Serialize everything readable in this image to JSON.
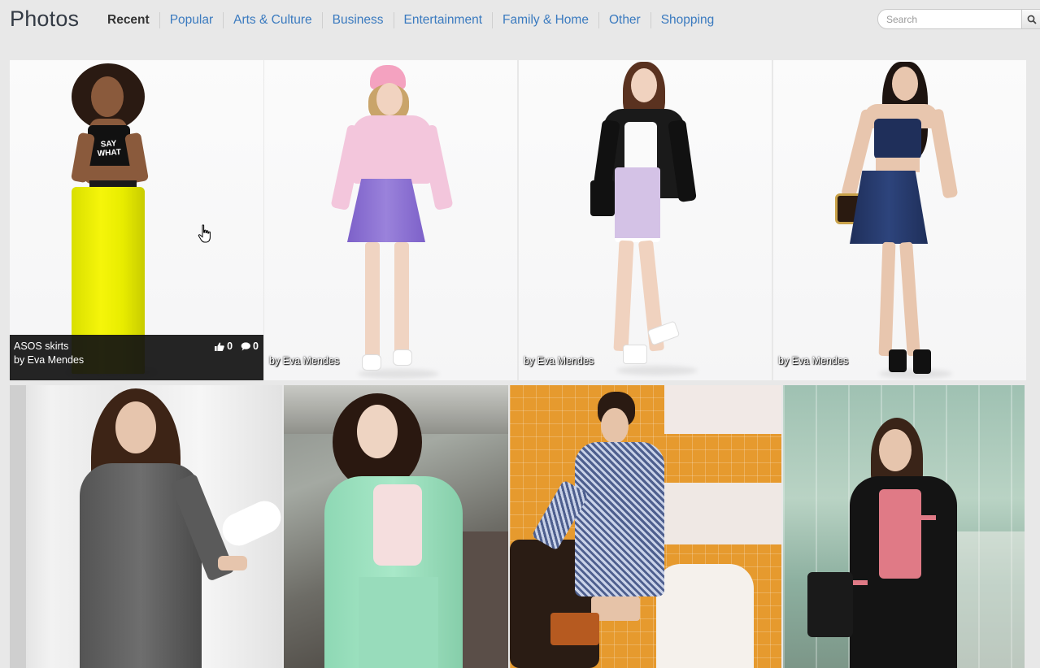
{
  "app": {
    "title": "Photos"
  },
  "nav": {
    "items": [
      {
        "label": "Recent",
        "active": true
      },
      {
        "label": "Popular",
        "active": false
      },
      {
        "label": "Arts & Culture",
        "active": false
      },
      {
        "label": "Business",
        "active": false
      },
      {
        "label": "Entertainment",
        "active": false
      },
      {
        "label": "Family & Home",
        "active": false
      },
      {
        "label": "Other",
        "active": false
      },
      {
        "label": "Shopping",
        "active": false
      }
    ]
  },
  "search": {
    "placeholder": "Search",
    "icon": "search-icon"
  },
  "photos": [
    {
      "title": "ASOS skirts",
      "author": "by Eva Mendes",
      "likes": "0",
      "comments": "0",
      "hovered": true
    },
    {
      "author": "by Eva Mendes"
    },
    {
      "author": "by Eva Mendes"
    },
    {
      "author": "by Eva Mendes"
    },
    {
      "author": ""
    },
    {
      "author": ""
    },
    {
      "author": ""
    },
    {
      "author": ""
    }
  ],
  "icons": {
    "like": "thumbs-up-icon",
    "comment": "comment-bubble-icon",
    "cursor": "hand-pointer-icon"
  },
  "colors": {
    "link": "#3a7abf",
    "active": "#333333",
    "background": "#e8e8e8",
    "overlay": "#111111"
  }
}
